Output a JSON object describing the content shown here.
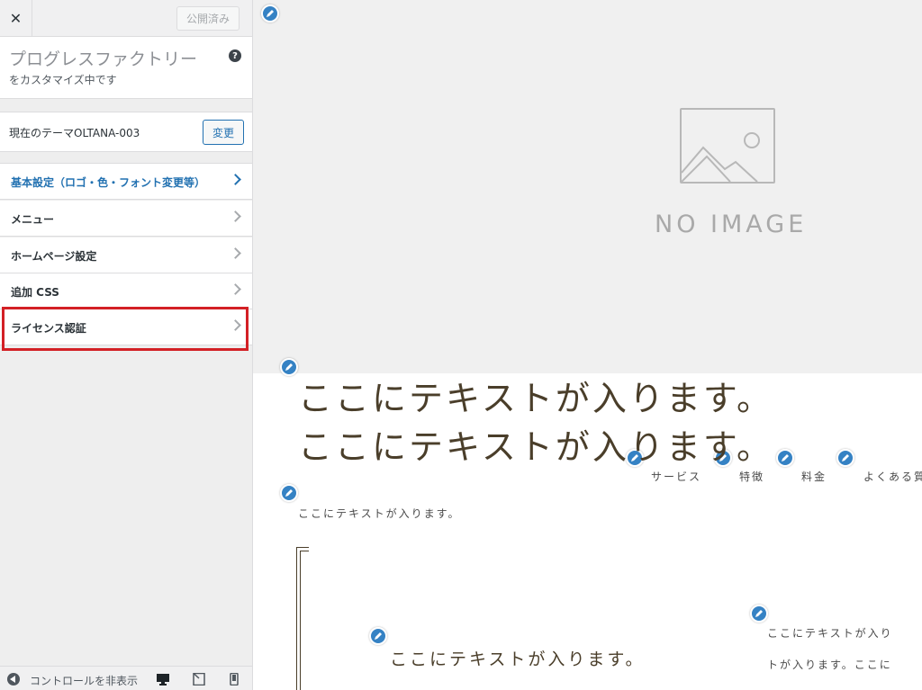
{
  "sidebar": {
    "close_label": "✕",
    "publish_label": "公開済み",
    "site_title": "プログレスファクトリー",
    "customizing_label": "をカスタマイズ中です",
    "help_icon": "?",
    "theme_label": "現在のテーマOLTANA-003",
    "change_label": "変更",
    "items": [
      {
        "label": "基本設定（ロゴ・色・フォント変更等）",
        "active": true
      },
      {
        "label": "メニュー"
      },
      {
        "label": "ホームページ設定"
      },
      {
        "label": "追加 CSS"
      },
      {
        "label": "ライセンス認証",
        "highlighted": true
      }
    ],
    "highlight_color": "#d32025",
    "footer": {
      "collapse_label": "コントロールを非表示",
      "device_icons": [
        "desktop-icon",
        "tablet-icon",
        "mobile-icon"
      ]
    }
  },
  "preview": {
    "no_image_label": "NO IMAGE",
    "heading_line1": "ここにテキストが入ります。",
    "heading_line2": "ここにテキストが入ります。",
    "nav": [
      "サービス",
      "特徴",
      "料金",
      "よくある質"
    ],
    "sub_text": "ここにテキストが入ります。",
    "mid_text": "ここにテキストが入ります。",
    "right_text_1": "ここにテキストが入り",
    "right_text_2": "トが入ります。ここに",
    "accent_color": "#3582c4"
  }
}
